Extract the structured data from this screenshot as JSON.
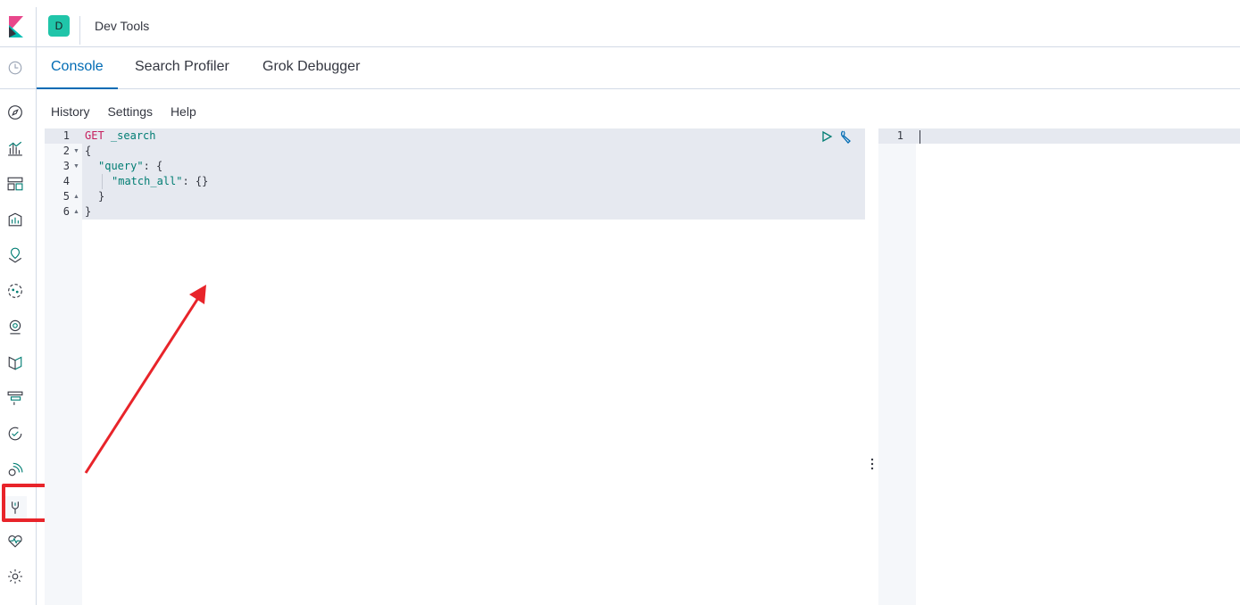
{
  "header": {
    "space_initial": "D",
    "title": "Dev Tools"
  },
  "sidebar": {
    "items": [
      {
        "name": "recent-icon"
      },
      {
        "name": "discover-icon"
      },
      {
        "name": "visualize-icon"
      },
      {
        "name": "dashboard-icon"
      },
      {
        "name": "canvas-icon"
      },
      {
        "name": "maps-icon"
      },
      {
        "name": "ml-icon"
      },
      {
        "name": "infrastructure-icon"
      },
      {
        "name": "logs-icon"
      },
      {
        "name": "apm-icon"
      },
      {
        "name": "uptime-icon"
      },
      {
        "name": "siem-icon"
      },
      {
        "name": "dev-tools-icon"
      },
      {
        "name": "monitoring-icon"
      },
      {
        "name": "management-icon"
      }
    ]
  },
  "tabs": [
    {
      "label": "Console",
      "active": true
    },
    {
      "label": "Search Profiler",
      "active": false
    },
    {
      "label": "Grok Debugger",
      "active": false
    }
  ],
  "menu": {
    "history": "History",
    "settings": "Settings",
    "help": "Help"
  },
  "editor": {
    "lines": [
      {
        "num": "1",
        "fold": "",
        "method": "GET",
        "path": "_search"
      },
      {
        "num": "2",
        "fold": "▼",
        "text": "{"
      },
      {
        "num": "3",
        "fold": "▼",
        "key": "\"query\"",
        "rest": ": {"
      },
      {
        "num": "4",
        "fold": "",
        "key": "\"match_all\"",
        "rest": ": {}"
      },
      {
        "num": "5",
        "fold": "▲",
        "text": "}"
      },
      {
        "num": "6",
        "fold": "▲",
        "text": "}"
      }
    ]
  },
  "output": {
    "line_number": "1"
  },
  "colors": {
    "accent": "#006bb4",
    "highlight": "#e8242a",
    "space": "#20c5a9"
  }
}
